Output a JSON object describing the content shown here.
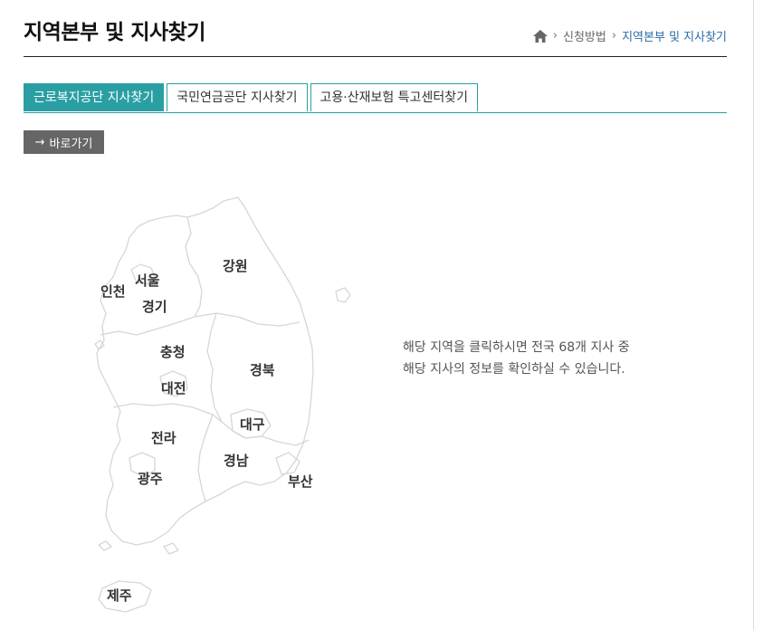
{
  "header": {
    "title": "지역본부 및 지사찾기",
    "breadcrumb": {
      "items": [
        "신청방법",
        "지역본부 및 지사찾기"
      ]
    }
  },
  "tabs": [
    {
      "label": "근로복지공단 지사찾기",
      "active": true
    },
    {
      "label": "국민연금공단 지사찾기",
      "active": false
    },
    {
      "label": "고용·산재보험 특고센터찾기",
      "active": false
    }
  ],
  "goto_button": {
    "label": "바로가기"
  },
  "regions": {
    "incheon": "인천",
    "seoul": "서울",
    "gyeonggi": "경기",
    "gangwon": "강원",
    "chungcheong": "충청",
    "daejeon": "대전",
    "gyeongbuk": "경북",
    "daegu": "대구",
    "jeolla": "전라",
    "gwangju": "광주",
    "gyeongnam": "경남",
    "busan": "부산",
    "jeju": "제주"
  },
  "info": {
    "line1": "해당 지역을 클릭하시면 전국 68개 지사 중",
    "line2": "해당 지사의 정보를 확인하실 수 있습니다."
  },
  "colors": {
    "accent": "#2a9fa3",
    "breadcrumb_current": "#2b6aa7",
    "button_bg": "#666666",
    "map_stroke": "#d6d6d6"
  }
}
